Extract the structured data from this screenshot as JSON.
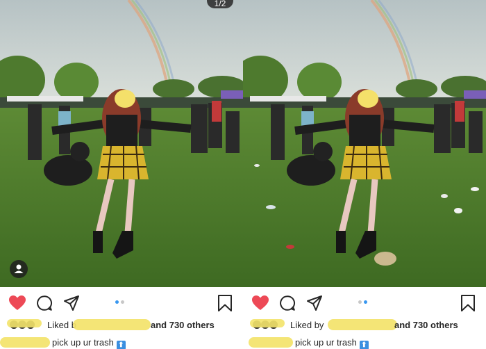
{
  "counter": "1/2",
  "posts": [
    {
      "side": "left",
      "liked_prefix": "Liked b",
      "liked_suffix": "and 730 others",
      "caption": "pick up ur trash",
      "caption_emoji": "⬆"
    },
    {
      "side": "right",
      "liked_prefix": "Liked by",
      "liked_suffix": "and 730 others",
      "caption": "pick up ur trash",
      "caption_emoji": "⬆"
    }
  ],
  "icons": {
    "like": "heart-icon",
    "comment": "comment-icon",
    "share": "share-icon",
    "save": "bookmark-icon",
    "tagged": "user-tag-icon",
    "emoji": "up-arrow-emoji-icon"
  },
  "colors": {
    "heart_red": "#ed4956",
    "dot_active": "#3897f0",
    "redaction_yellow": "#f3e36a",
    "grass": "#4f7a2c",
    "sky": "#c7cfc9"
  }
}
